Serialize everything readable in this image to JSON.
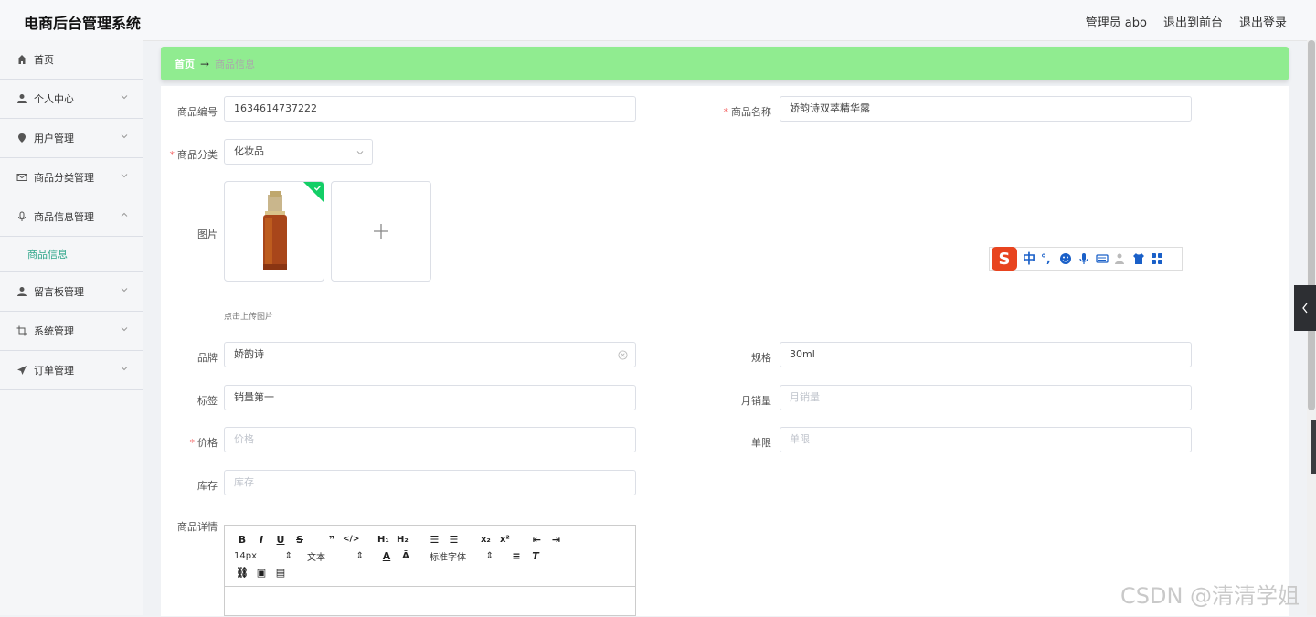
{
  "app": {
    "title": "电商后台管理系统"
  },
  "header": {
    "admin": "管理员 abo",
    "front": "退出到前台",
    "logout": "退出登录"
  },
  "sidebar": {
    "items": [
      {
        "label": "首页",
        "icon": "home-icon"
      },
      {
        "label": "个人中心",
        "icon": "user-icon"
      },
      {
        "label": "用户管理",
        "icon": "location-icon"
      },
      {
        "label": "商品分类管理",
        "icon": "mail-icon"
      },
      {
        "label": "商品信息管理",
        "icon": "microphone-icon"
      },
      {
        "label": "留言板管理",
        "icon": "user-icon"
      },
      {
        "label": "系统管理",
        "icon": "crop-icon"
      },
      {
        "label": "订单管理",
        "icon": "send-icon"
      }
    ],
    "sub_active": "商品信息"
  },
  "breadcrumb": {
    "home": "首页",
    "current": "商品信息"
  },
  "form": {
    "code_label": "商品编号",
    "code_value": "1634614737222",
    "name_label": "商品名称",
    "name_value": "娇韵诗双萃精华露",
    "category_label": "商品分类",
    "category_value": "化妆品",
    "image_label": "图片",
    "upload_hint": "点击上传图片",
    "brand_label": "品牌",
    "brand_value": "娇韵诗",
    "spec_label": "规格",
    "spec_value": "30ml",
    "tag_label": "标签",
    "tag_value": "销量第一",
    "monthly_label": "月销量",
    "monthly_placeholder": "月销量",
    "price_label": "价格",
    "price_placeholder": "价格",
    "limit_label": "单限",
    "limit_placeholder": "单限",
    "stock_label": "库存",
    "stock_placeholder": "库存",
    "detail_label": "商品详情"
  },
  "editor": {
    "font_size": "14px",
    "paragraph": "文本",
    "font_family": "标准字体"
  },
  "watermark": "CSDN @清清学姐",
  "colors": {
    "accent": "#2fa68a",
    "breadcrumb_bg": "#90ec90",
    "required": "#f56c6c",
    "success": "#13ce66"
  }
}
